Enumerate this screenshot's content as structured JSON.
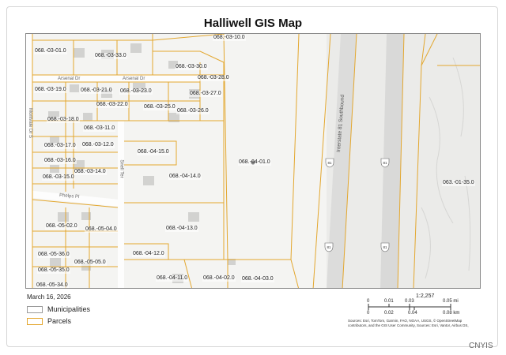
{
  "title": "Halliwell GIS Map",
  "date": "March 16, 2026",
  "legend": [
    {
      "label": "Municipalities",
      "color": "#9a9a9a"
    },
    {
      "label": "Parcels",
      "color": "#e3a72f"
    }
  ],
  "scale": {
    "ratio": "1:2,257",
    "mi_ticks": [
      "0",
      "0.01",
      "0.03",
      "0.05 mi"
    ],
    "km_ticks": [
      "0",
      "0.02",
      "0.04",
      "0.08 km"
    ]
  },
  "attribution": "Sources: Esri, TomTom, Garmin, FAO, NOAA, USGS, © OpenStreetMap contributors, and the GIS User Community, Sources: Esri, Vantor, Airbus DS,",
  "watermark": "CNYIS",
  "colors": {
    "parcel": "#e3a72f",
    "road": "#ffffff",
    "highway": "#d9d9d9",
    "background": "#f3f3f2"
  },
  "map": {
    "highway_label": "Interstate 81 Southbound",
    "streets": [
      "Arsenal Dr",
      "Arsenal Dr",
      "Montvale Dr S",
      "Snell Ter",
      "Phelps Pl"
    ],
    "parcels": [
      "068.-03-10.0",
      "068.-03-01.0",
      "068.-03-33.0",
      "068.-03-30.0",
      "068.-03-28.0",
      "068.-03-19.0",
      "068.-03-21.0",
      "068.-03-23.0",
      "068.-03-27.0",
      "068.-03-22.0",
      "068.-03-25.0",
      "068.-03-26.0",
      "068.-03-18.0",
      "068.-03-11.0",
      "068.-03-17.0",
      "068.-03-12.0",
      "068.-03-16.0",
      "068.-03-14.0",
      "068.-03-15.0",
      "068.-04-15.0",
      "068.-04-14.0",
      "068.-04-01.0",
      "063.-01-35.0",
      "068.-05-02.0",
      "068.-05-04.0",
      "068.-04-13.0",
      "068.-05-36.0",
      "068.-05-05.0",
      "068.-04-12.0",
      "068.-05-35.0",
      "068.-04-11.0",
      "068.-04-02.0",
      "068.-04-03.0",
      "068.-05-34.0"
    ],
    "shields": [
      "81",
      "81",
      "81",
      "81"
    ]
  }
}
